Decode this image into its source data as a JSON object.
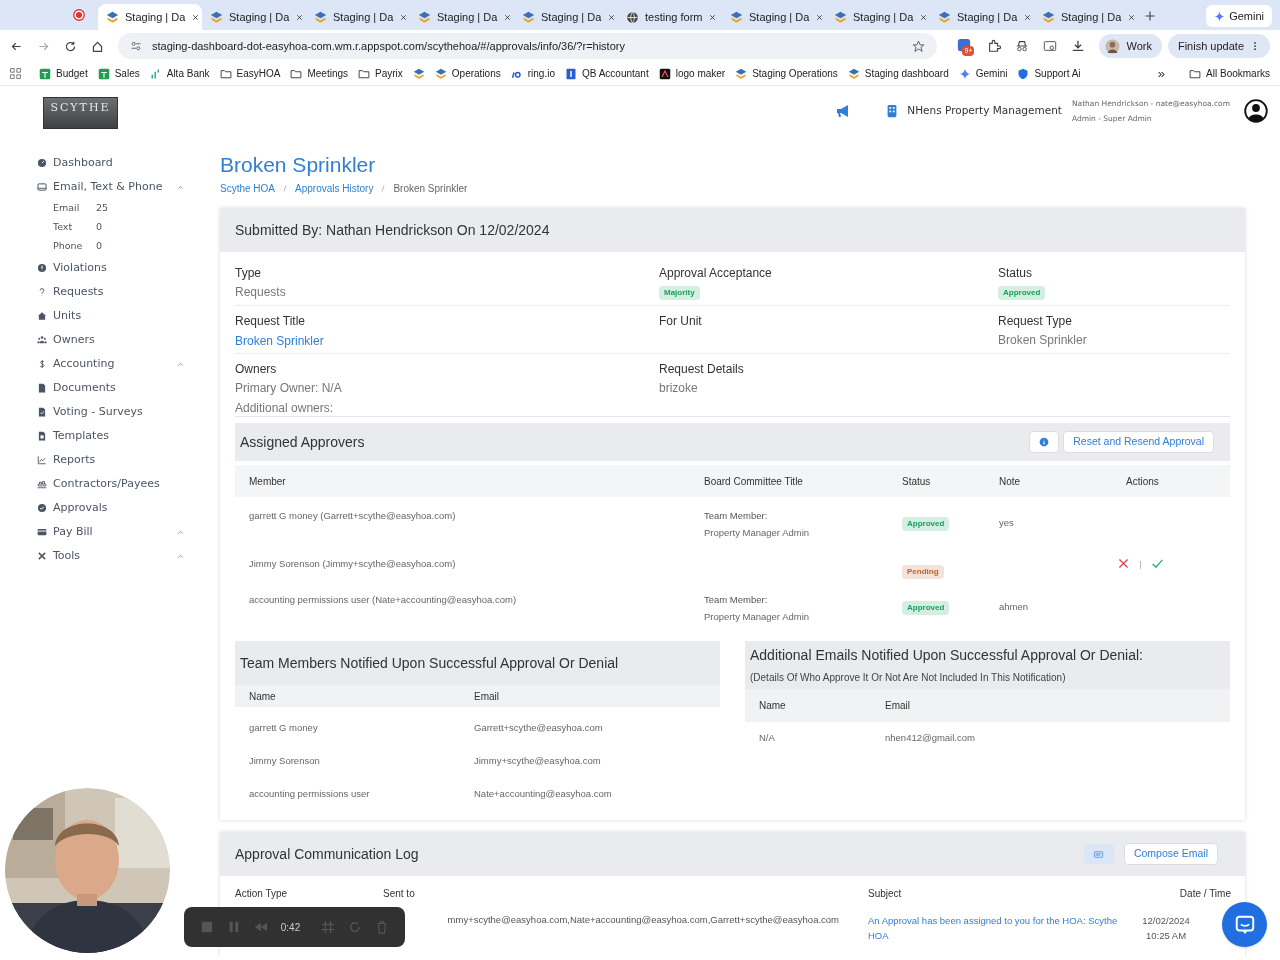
{
  "browser": {
    "tabs": [
      {
        "title": "Staging | Da",
        "selected": true,
        "kind": "site"
      },
      {
        "title": "Staging | Da",
        "selected": false,
        "kind": "site"
      },
      {
        "title": "Staging | Da",
        "selected": false,
        "kind": "site"
      },
      {
        "title": "Staging | Da",
        "selected": false,
        "kind": "site"
      },
      {
        "title": "Staging | Da",
        "selected": false,
        "kind": "site"
      },
      {
        "title": "testing form",
        "selected": false,
        "kind": "globe"
      },
      {
        "title": "Staging | Da",
        "selected": false,
        "kind": "site"
      },
      {
        "title": "Staging | Da",
        "selected": false,
        "kind": "site"
      },
      {
        "title": "Staging | Da",
        "selected": false,
        "kind": "site"
      },
      {
        "title": "Staging | Da",
        "selected": false,
        "kind": "site"
      }
    ],
    "gemini": "Gemini",
    "url": "staging-dashboard-dot-easyhoa-com.wm.r.appspot.com/scythehoa/#/approvals/info/36/?r=history",
    "extension_badge": "9+",
    "profile": "Work",
    "update": "Finish update",
    "bookmarks": [
      {
        "label": "Budget",
        "kind": "sheet"
      },
      {
        "label": "Sales",
        "kind": "sheet"
      },
      {
        "label": "Alta Bank",
        "kind": "bars"
      },
      {
        "label": "EasyHOA",
        "kind": "folder"
      },
      {
        "label": "Meetings",
        "kind": "folder"
      },
      {
        "label": "Payrix",
        "kind": "folder"
      },
      {
        "kind": "site"
      },
      {
        "label": "Operations",
        "kind": "site"
      },
      {
        "label": "ring.io",
        "kind": "io"
      },
      {
        "label": "QB Accountant",
        "kind": "book"
      },
      {
        "label": "logo maker",
        "kind": "logo"
      },
      {
        "label": "Staging Operations",
        "kind": "site"
      },
      {
        "label": "Staging dashboard",
        "kind": "site"
      },
      {
        "label": "Gemini",
        "kind": "spark"
      },
      {
        "label": "Support Ai",
        "kind": "shield"
      }
    ],
    "more": "»",
    "all_bookmarks": "All Bookmarks"
  },
  "header": {
    "org": "NHens Property Management",
    "user": "Nathan Hendrickson - nate@easyhoa.com",
    "role": "Admin - Super Admin"
  },
  "logo": "SCYTHE",
  "sidebar": [
    {
      "label": "Dashboard",
      "chevron": false
    },
    {
      "label": "Email, Text & Phone",
      "chevron": true,
      "children": [
        {
          "label": "Email",
          "count": "25"
        },
        {
          "label": "Text",
          "count": "0"
        },
        {
          "label": "Phone",
          "count": "0"
        }
      ]
    },
    {
      "label": "Violations",
      "chevron": false
    },
    {
      "label": "Requests",
      "chevron": false
    },
    {
      "label": "Units",
      "chevron": false
    },
    {
      "label": "Owners",
      "chevron": false
    },
    {
      "label": "Accounting",
      "chevron": true
    },
    {
      "label": "Documents",
      "chevron": false
    },
    {
      "label": "Voting - Surveys",
      "chevron": false
    },
    {
      "label": "Templates",
      "chevron": false
    },
    {
      "label": "Reports",
      "chevron": false
    },
    {
      "label": "Contractors/Payees",
      "chevron": false
    },
    {
      "label": "Approvals",
      "chevron": false
    },
    {
      "label": "Pay Bill",
      "chevron": true
    },
    {
      "label": "Tools",
      "chevron": true
    }
  ],
  "title": "Broken Sprinkler",
  "breadcrumbs": [
    {
      "label": "Scythe HOA",
      "link": true
    },
    {
      "label": "Approvals History",
      "link": true
    },
    {
      "label": "Broken Sprinkler",
      "link": false
    }
  ],
  "submitted": "Submitted By: Nathan Hendrickson On 12/02/2024",
  "details": [
    [
      {
        "label": "Type",
        "values": [
          "Requests"
        ]
      },
      {
        "label": "Approval Acceptance",
        "badge": "Majority",
        "color": "#17a05d"
      },
      {
        "label": "Status",
        "badge": "Approved",
        "color": "#17a05d"
      }
    ],
    [
      {
        "label": "Request Title",
        "link": "Broken Sprinkler"
      },
      {
        "label": "For Unit"
      },
      {
        "label": "Request Type",
        "values": [
          "Broken Sprinkler"
        ]
      }
    ],
    [
      {
        "label": "Owners",
        "values": [
          "Primary Owner: N/A",
          "Additional owners:"
        ]
      },
      {
        "label": "Request Details",
        "values": [
          "brizoke"
        ]
      }
    ]
  ],
  "approvers": {
    "title": "Assigned Approvers",
    "button": "Reset and Resend Approval",
    "columns": [
      "Member",
      "Board Committee Title",
      "Status",
      "Note",
      "Actions"
    ],
    "rows": [
      {
        "member": "garrett G money (Garrett+scythe@easyhoa.com)",
        "title_role": "Team Member:",
        "title_detail": "Property Manager Admin",
        "status": "Approved",
        "color": "#17a05d",
        "note": "yes",
        "actions": false
      },
      {
        "member": "Jimmy Sorenson (Jimmy+scythe@easyhoa.com)",
        "status": "Pending",
        "color": "#c2612d",
        "actions": true
      },
      {
        "member": "accounting permissions user (Nate+accounting@easyhoa.com)",
        "title_role": "Team Member:",
        "title_detail": "Property Manager Admin",
        "status": "Approved",
        "color": "#17a05d",
        "note": "ahmen",
        "actions": false
      }
    ]
  },
  "team_notified": {
    "title": "Team Members Notified Upon Successful Approval Or Denial",
    "columns": [
      "Name",
      "Email"
    ],
    "rows": [
      [
        "garrett G money",
        "Garrett+scythe@easyhoa.com"
      ],
      [
        "Jimmy Sorenson",
        "Jimmy+scythe@easyhoa.com"
      ],
      [
        "accounting permissions user",
        "Nate+accounting@easyhoa.com"
      ]
    ]
  },
  "additional_emails": {
    "title": "Additional Emails Notified Upon Successful Approval Or Denial:",
    "subtitle": "(Details Of Who Approve It Or Not Are Not Included In This Notification)",
    "columns": [
      "Name",
      "Email"
    ],
    "rows": [
      [
        "N/A",
        "nhen412@gmail.com"
      ]
    ]
  },
  "log": {
    "title": "Approval Communication Log",
    "button": "Compose Email",
    "columns": [
      "Action Type",
      "Sent to",
      "Subject",
      "Date / Time"
    ],
    "rows": [
      {
        "sent_to": "mmy+scythe@easyhoa.com,Nate+accounting@easyhoa.com,Garrett+scythe@easyhoa.com",
        "subject": "An Approval has been assigned to you for the HOA: Scythe HOA",
        "date": "12/02/2024 10:25 AM"
      }
    ]
  },
  "recorder": {
    "time": "0:42"
  }
}
